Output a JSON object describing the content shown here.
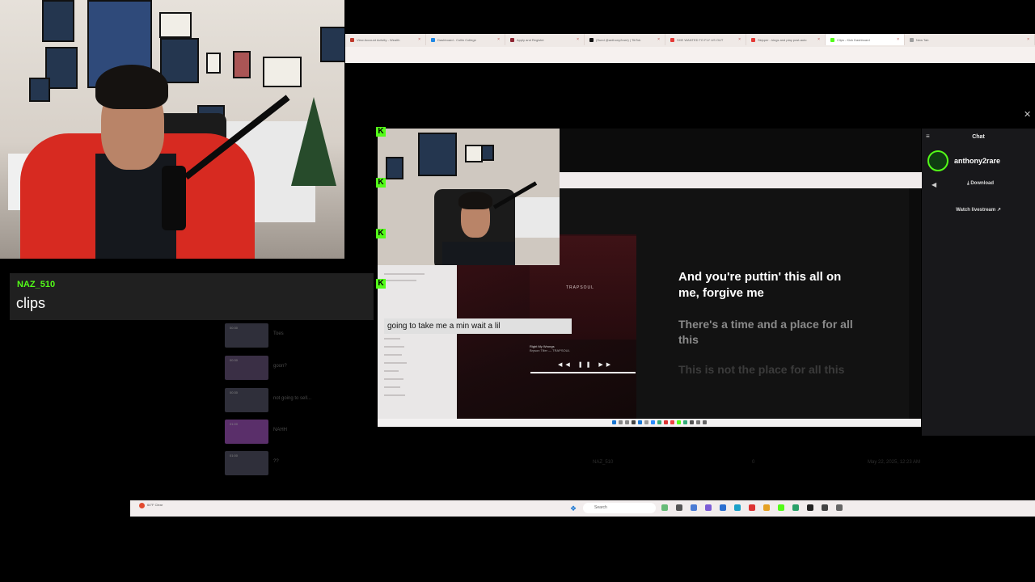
{
  "browser": {
    "tabs": [
      {
        "label": "View Account Activity - Wealth",
        "color": "#c0392b",
        "active": false
      },
      {
        "label": "Dashboard - Collin College",
        "color": "#1e88e5",
        "active": false
      },
      {
        "label": "Apply and Register",
        "color": "#8e2430",
        "active": false
      },
      {
        "label": "(Sued @anthony2rare) | TikTok",
        "color": "#111111",
        "active": false
      },
      {
        "label": "SHE WANTED TO FLY US OUT",
        "color": "#e53935",
        "active": false
      },
      {
        "label": "Skipper - kings and play post-auto",
        "color": "#e53935",
        "active": false
      },
      {
        "label": "Clips - Kick Dashboard",
        "color": "#53fc18",
        "active": true
      },
      {
        "label": "New Tab",
        "color": "#9e9e9e",
        "active": false
      }
    ]
  },
  "chat_message": {
    "username": "NAZ_510",
    "text": "clips"
  },
  "clip_list": {
    "rows": [
      {
        "duration": "00:30",
        "title": "Toes"
      },
      {
        "duration": "00:30",
        "title": "goon?"
      },
      {
        "duration": "00:30",
        "title": "not going to sell..."
      },
      {
        "duration": "01:00",
        "title": "NAHH"
      },
      {
        "duration": "01:00",
        "title": "??"
      }
    ],
    "meta": {
      "creator": "NAZ_510",
      "views": "0",
      "date": "May 22, 2025, 12:23 AM"
    }
  },
  "player": {
    "caption": "going to take me a min wait a lil",
    "album_title": "TRAPSOUL",
    "song_title": "Right My Wrongs",
    "song_artist": "Bryson Tiller — TRAPSOUL",
    "lyrics": [
      "And you're puttin' this all on me, forgive me",
      "There's a time and a place for all this",
      "This is not the place for all this"
    ]
  },
  "chat_panel": {
    "title": "Chat",
    "streamer": "anthony2rare",
    "download_label": "Download",
    "watch_label": "Watch livestream"
  },
  "taskbar": {
    "weather": "64°F Clear",
    "search_placeholder": "Search"
  },
  "icons": {
    "close": "close-icon",
    "menu": "menu-icon",
    "back": "back-arrow-icon",
    "download": "download-icon",
    "external": "external-link-icon",
    "kick": "kick-logo-icon"
  },
  "colors": {
    "kick_green": "#53fc18",
    "chat_bg": "#18181b",
    "page_bg": "#000000"
  }
}
